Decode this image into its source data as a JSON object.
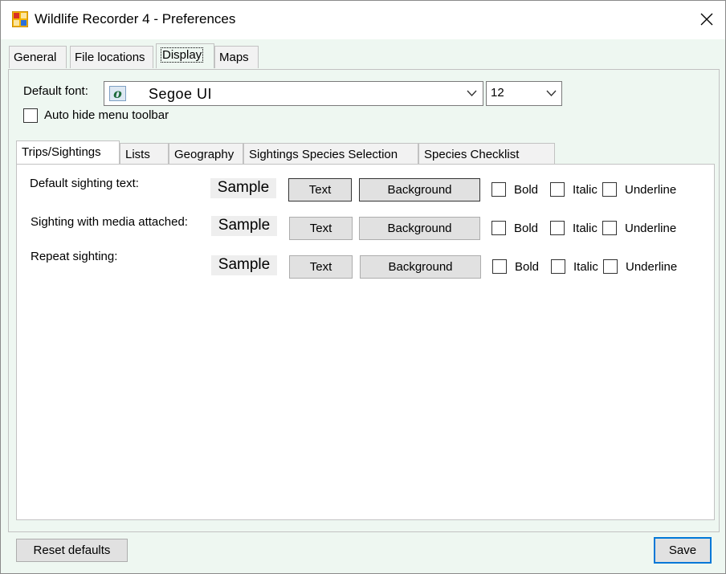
{
  "window": {
    "title": "Wildlife Recorder 4 - Preferences"
  },
  "tabs": [
    "General",
    "File locations",
    "Display",
    "Maps"
  ],
  "active_tab": "Display",
  "display": {
    "default_font_label": "Default font:",
    "font_value": "Segoe UI",
    "font_size_value": "12",
    "auto_hide_label": "Auto hide menu toolbar",
    "sub_tabs": [
      "Trips/Sightings",
      "Lists",
      "Geography",
      "Sightings Species Selection",
      "Species Checklist"
    ],
    "active_sub_tab": "Trips/Sightings",
    "rows": [
      {
        "label": "Default sighting text:",
        "sample": "Sample",
        "text_btn": "Text",
        "background_btn": "Background",
        "bold": "Bold",
        "italic": "Italic",
        "underline": "Underline"
      },
      {
        "label": "Sighting with media attached:",
        "sample": "Sample",
        "text_btn": "Text",
        "background_btn": "Background",
        "bold": "Bold",
        "italic": "Italic",
        "underline": "Underline"
      },
      {
        "label": "Repeat sighting:",
        "sample": "Sample",
        "text_btn": "Text",
        "background_btn": "Background",
        "bold": "Bold",
        "italic": "Italic",
        "underline": "Underline"
      }
    ]
  },
  "footer": {
    "reset_label": "Reset defaults",
    "save_label": "Save"
  },
  "icons": {
    "app": "app-windows-icon",
    "close": "close-icon",
    "font": "font-type-icon",
    "dropdown": "chevron-down-icon"
  },
  "colors": {
    "window_bg": "#eef7f1",
    "focus": "#0078d7"
  }
}
